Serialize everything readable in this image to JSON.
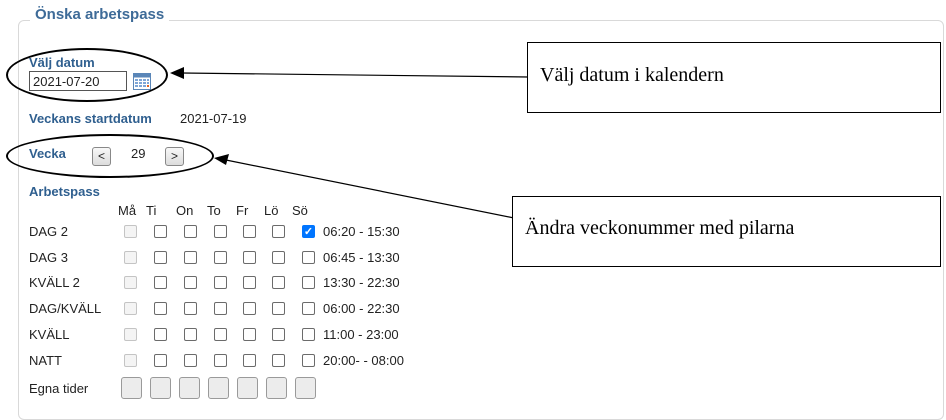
{
  "section": {
    "title": "Önska arbetspass"
  },
  "date_picker": {
    "label": "Välj datum",
    "value": "2021-07-20"
  },
  "week_start": {
    "label": "Veckans startdatum",
    "value": "2021-07-19"
  },
  "week_nav": {
    "label": "Vecka",
    "prev": "<",
    "number": "29",
    "next": ">"
  },
  "shifts": {
    "label": "Arbetspass",
    "days": [
      "Må",
      "Ti",
      "On",
      "To",
      "Fr",
      "Lö",
      "Sö"
    ],
    "rows": [
      {
        "name": "DAG 2",
        "time": "06:20 - 15:30",
        "checked_day": "Sö"
      },
      {
        "name": "DAG 3",
        "time": "06:45 - 13:30"
      },
      {
        "name": "KVÄLL 2",
        "time": "13:30 - 22:30"
      },
      {
        "name": "DAG/KVÄLL",
        "time": "06:00 - 22:30"
      },
      {
        "name": "KVÄLL",
        "time": "11:00 - 23:00"
      },
      {
        "name": "NATT",
        "time": "20:00- - 08:00"
      }
    ],
    "custom_label": "Egna tider"
  },
  "annotations": {
    "calendar_note": "Välj datum i kalendern",
    "week_note": "Ändra veckonummer med pilarna"
  },
  "colors": {
    "label_blue": "#2f5f8f",
    "checkbox_checked": "#0075ff"
  }
}
